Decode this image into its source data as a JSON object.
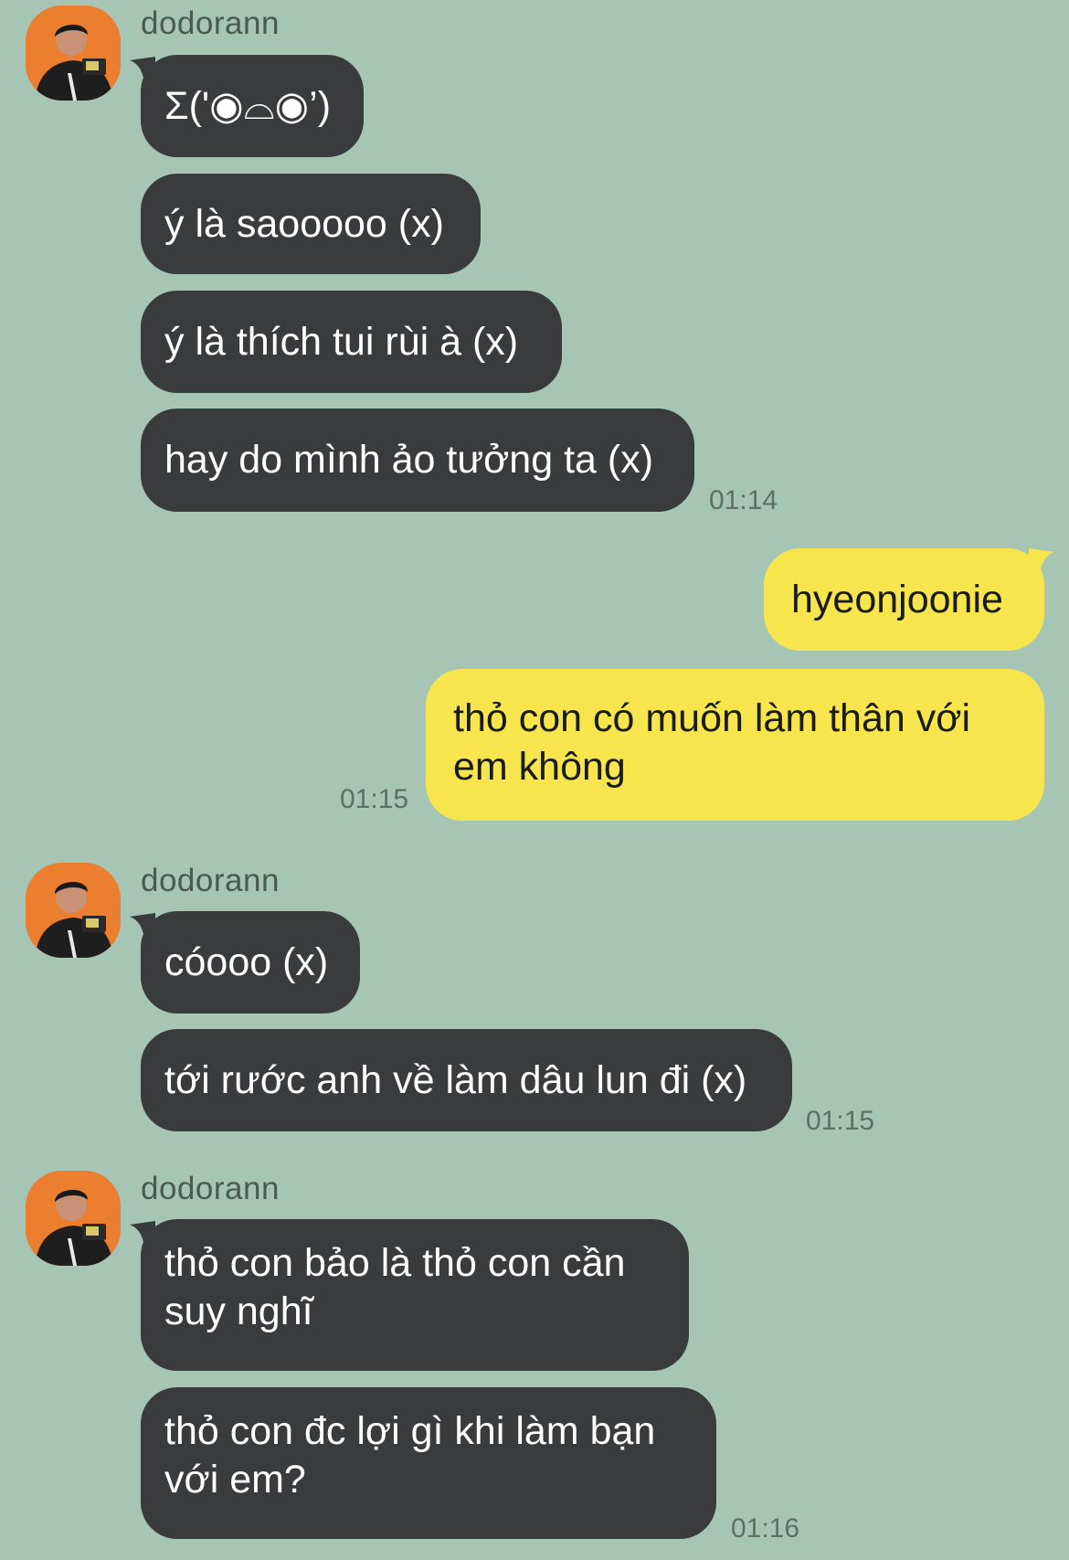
{
  "groups": [
    {
      "sender": "dodorann",
      "messages": [
        "Σ('◉⌓◉’)",
        "ý là saooooo (x)",
        "ý là thích tui rùi à (x)",
        "hay do mình ảo tưởng ta (x)"
      ],
      "time": "01:14"
    },
    {
      "sender": "dodorann",
      "messages": [
        "cóooo (x)",
        "tới rước anh về làm dâu lun đi (x)"
      ],
      "time": "01:15"
    },
    {
      "sender": "dodorann",
      "messages": [
        "thỏ con bảo là thỏ con cần\nsuy nghĩ",
        "thỏ con đc lợi gì khi làm bạn\nvới em?"
      ],
      "time": "01:16"
    }
  ],
  "me": {
    "messages": [
      "hyeonjoonie",
      "thỏ con có muốn làm thân với\nem không"
    ],
    "time": "01:15"
  },
  "colors": {
    "background": "#a6c5b4",
    "incoming_bubble": "#3a3b3d",
    "outgoing_bubble": "#f6e54d"
  }
}
